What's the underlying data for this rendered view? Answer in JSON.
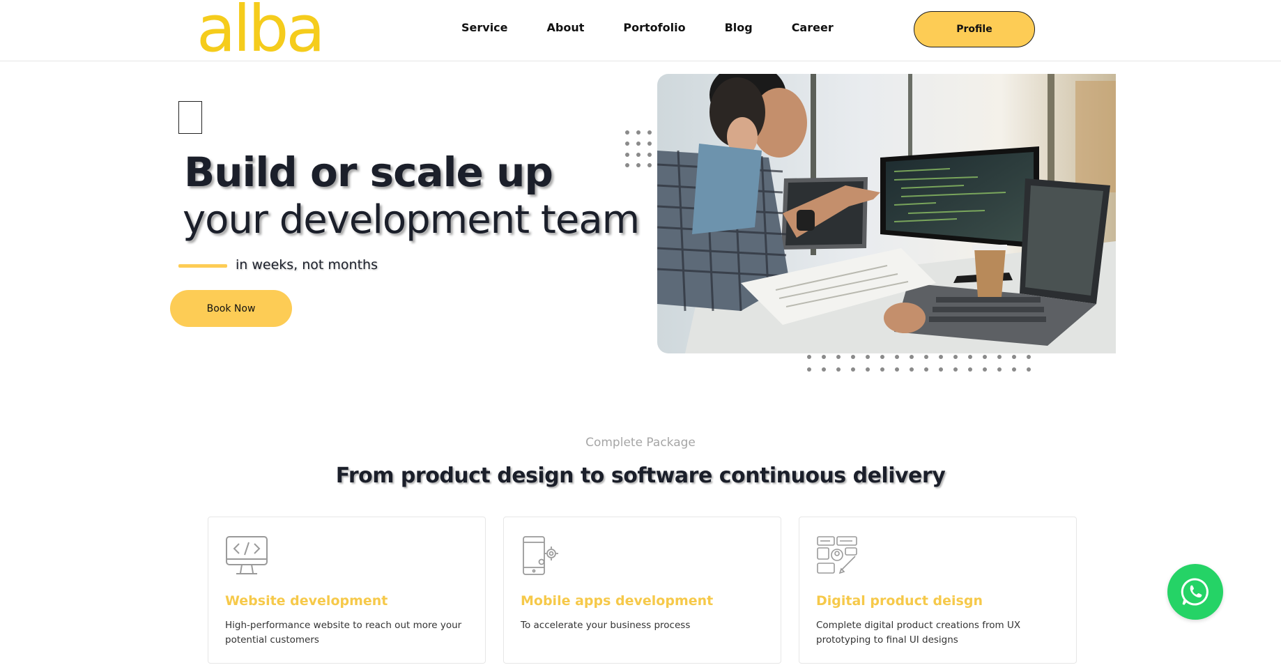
{
  "brand": {
    "logo_text": "alba",
    "accent": "#f5cc1c",
    "button_color": "#fdcc55"
  },
  "nav": {
    "items": [
      {
        "label": "Service"
      },
      {
        "label": "About"
      },
      {
        "label": "Portofolio"
      },
      {
        "label": "Blog"
      },
      {
        "label": "Career"
      }
    ],
    "profile_label": "Profile"
  },
  "hero": {
    "title": "Build or scale up",
    "subtitle": "your development team",
    "tagline": "in weeks, not months",
    "cta_label": "Book Now"
  },
  "section": {
    "eyebrow": "Complete Package",
    "title": "From product design to software continuous delivery",
    "cards": [
      {
        "icon": "monitor-code-icon",
        "title": "Website development",
        "desc": "High-performance website to reach out more your potential customers"
      },
      {
        "icon": "mobile-gear-icon",
        "title": "Mobile apps development",
        "desc": "To accelerate your business process"
      },
      {
        "icon": "design-layout-icon",
        "title": "Digital product deisgn",
        "desc": "Complete digital product creations from UX prototyping to final UI designs"
      }
    ]
  },
  "floating": {
    "icon": "whatsapp-icon",
    "color": "#25d366"
  }
}
